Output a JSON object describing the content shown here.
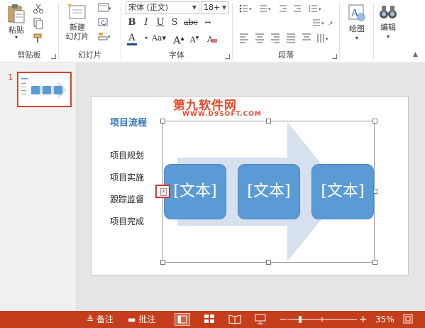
{
  "ribbon": {
    "clipboard": {
      "label": "剪贴板",
      "paste_label": "粘贴"
    },
    "slides": {
      "label": "幻灯片",
      "new_slide_line1": "新建",
      "new_slide_line2": "幻灯片"
    },
    "font": {
      "label": "字体",
      "font_name": "宋体 (正文)",
      "font_size": "18+",
      "bold": "B",
      "italic": "I",
      "underline": "U",
      "strike": "S",
      "shadow": "abc",
      "case": "Aa",
      "color": "A",
      "grow": "A",
      "shrink": "A"
    },
    "paragraph": {
      "label": "段落"
    },
    "drawing": {
      "label": "绘图"
    },
    "editing": {
      "label": "编辑"
    }
  },
  "thumbnail": {
    "number": "1"
  },
  "slide": {
    "title": "项目流程",
    "items": [
      "项目规划",
      "项目实施",
      "跟踪监督",
      "项目完成"
    ],
    "boxes": [
      "[文本]",
      "[文本]",
      "[文本]"
    ]
  },
  "watermark": {
    "main": "第九软件网",
    "sub": "WWW.D9SOFT.COM"
  },
  "statusbar": {
    "notes_label": "备注",
    "comments_label": "批注",
    "zoom_value": "35%",
    "minus": "−",
    "plus": "+"
  },
  "colors": {
    "accent": "#c43e1c",
    "smartart_blue": "#5b9bd5",
    "arrow_light": "#d6e0ee",
    "title_blue": "#2e75b6"
  }
}
